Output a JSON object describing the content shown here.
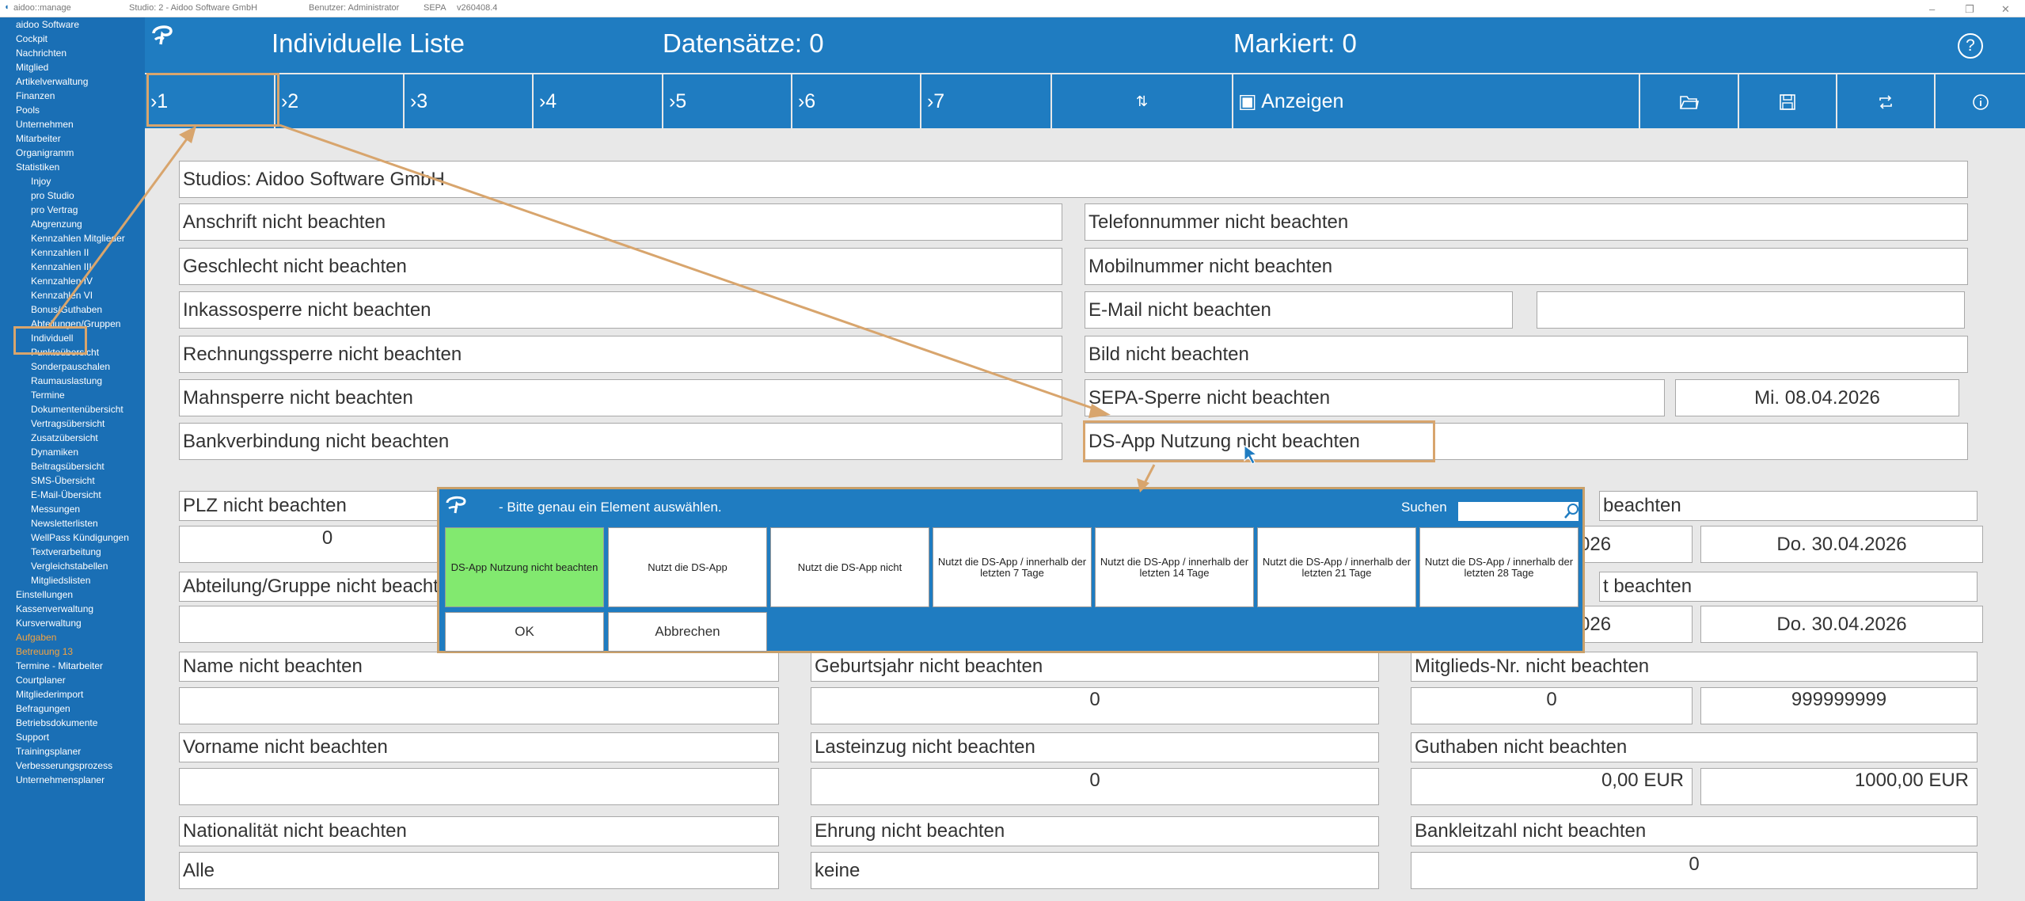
{
  "titlebar": {
    "app": "aidoo::manage",
    "studio": "Studio: 2 - Aidoo Software GmbH",
    "user": "Benutzer: Administrator",
    "sepa": "SEPA",
    "version": "v260408.4",
    "min": "–",
    "max": "❐",
    "close": "✕"
  },
  "sidebar": [
    {
      "label": "aidoo Software",
      "level": 0
    },
    {
      "label": "Cockpit",
      "level": 0
    },
    {
      "label": "Nachrichten",
      "level": 0
    },
    {
      "label": "Mitglied",
      "level": 0
    },
    {
      "label": "Artikelverwaltung",
      "level": 0
    },
    {
      "label": "Finanzen",
      "level": 0
    },
    {
      "label": "Pools",
      "level": 0
    },
    {
      "label": "Unternehmen",
      "level": 0
    },
    {
      "label": "Mitarbeiter",
      "level": 0
    },
    {
      "label": "Organigramm",
      "level": 0
    },
    {
      "label": "Statistiken",
      "level": 0
    },
    {
      "label": "Injoy",
      "level": 1
    },
    {
      "label": "pro Studio",
      "level": 1
    },
    {
      "label": "pro Vertrag",
      "level": 1
    },
    {
      "label": "Abgrenzung",
      "level": 1
    },
    {
      "label": "Kennzahlen Mitglieder",
      "level": 1
    },
    {
      "label": "Kennzahlen II",
      "level": 1
    },
    {
      "label": "Kennzahlen III",
      "level": 1
    },
    {
      "label": "Kennzahlen IV",
      "level": 1
    },
    {
      "label": "Kennzahlen VI",
      "level": 1
    },
    {
      "label": "Bonus/Guthaben",
      "level": 1
    },
    {
      "label": "Abteilungen/Gruppen",
      "level": 1
    },
    {
      "label": "Individuell",
      "level": 1
    },
    {
      "label": "Punkteübersicht",
      "level": 1
    },
    {
      "label": "Sonderpauschalen",
      "level": 1
    },
    {
      "label": "Raumauslastung",
      "level": 1
    },
    {
      "label": "Termine",
      "level": 1
    },
    {
      "label": "Dokumentenübersicht",
      "level": 1
    },
    {
      "label": "Vertragsübersicht",
      "level": 1
    },
    {
      "label": "Zusatzübersicht",
      "level": 1
    },
    {
      "label": "Dynamiken",
      "level": 1
    },
    {
      "label": "Beitragsübersicht",
      "level": 1
    },
    {
      "label": "SMS-Übersicht",
      "level": 1
    },
    {
      "label": "E-Mail-Übersicht",
      "level": 1
    },
    {
      "label": "Messungen",
      "level": 1
    },
    {
      "label": "Newsletterlisten",
      "level": 1
    },
    {
      "label": "WellPass Kündigungen",
      "level": 1
    },
    {
      "label": "Textverarbeitung",
      "level": 1
    },
    {
      "label": "Vergleichstabellen",
      "level": 1
    },
    {
      "label": "Mitgliedslisten",
      "level": 1
    },
    {
      "label": "Einstellungen",
      "level": 0
    },
    {
      "label": "Kassenverwaltung",
      "level": 0
    },
    {
      "label": "Kursverwaltung",
      "level": 0
    },
    {
      "label": "Aufgaben",
      "level": 0,
      "orange": true
    },
    {
      "label": "Betreuung 13",
      "level": 0,
      "orange": true
    },
    {
      "label": "Termine - Mitarbeiter",
      "level": 0
    },
    {
      "label": "Courtplaner",
      "level": 0
    },
    {
      "label": "Mitgliederimport",
      "level": 0
    },
    {
      "label": "Befragungen",
      "level": 0
    },
    {
      "label": "Betriebsdokumente",
      "level": 0
    },
    {
      "label": "Support",
      "level": 0
    },
    {
      "label": "Trainingsplaner",
      "level": 0
    },
    {
      "label": "Verbesserungsprozess",
      "level": 0
    },
    {
      "label": "Unternehmensplaner",
      "level": 0
    }
  ],
  "header": {
    "title": "Individuelle Liste",
    "records": "Datensätze: 0",
    "marked": "Markiert: 0",
    "help": "?"
  },
  "tabs": {
    "t1": "1",
    "t2": "2",
    "t3": "3",
    "t4": "4",
    "t5": "5",
    "t6": "6",
    "t7": "7",
    "sort": "⇅",
    "show": "Anzeigen"
  },
  "fields": {
    "studios": "Studios: Aidoo Software GmbH",
    "anschrift": "Anschrift nicht beachten",
    "telefon": "Telefonnummer nicht beachten",
    "geschlecht": "Geschlecht nicht beachten",
    "mobil": "Mobilnummer nicht beachten",
    "inkasso": "Inkassosperre nicht beachten",
    "email": "E-Mail nicht beachten",
    "email_value": "",
    "rechnung": "Rechnungssperre nicht beachten",
    "bild": "Bild nicht beachten",
    "mahn": "Mahnsperre nicht beachten",
    "sepa": "SEPA-Sperre nicht beachten",
    "sepa_date": "Mi. 08.04.2026",
    "bank": "Bankverbindung nicht beachten",
    "dsapp": "DS-App Nutzung nicht beachten",
    "plz": "PLZ nicht beachten",
    "plz_value": "0",
    "right1": "beachten",
    "date_a": "026",
    "date_b": "Do. 30.04.2026",
    "abteilung": "Abteilung/Gruppe nicht beachten",
    "right2": "t beachten",
    "date_c": "026",
    "date_d": "Do. 30.04.2026",
    "name": "Name nicht beachten",
    "gebjahr": "Geburtsjahr nicht beachten",
    "gebjahr_value": "0",
    "mitgliedsnr": "Mitglieds-Nr. nicht beachten",
    "nr_from": "0",
    "nr_to": "999999999",
    "vorname": "Vorname nicht beachten",
    "lasteinzug": "Lasteinzug nicht beachten",
    "lasteinzug_value": "0",
    "guthaben": "Guthaben nicht beachten",
    "guthaben_from": "0,00 EUR",
    "guthaben_to": "1000,00 EUR",
    "nationalitaet": "Nationalität nicht beachten",
    "nat_value": "Alle",
    "ehrung": "Ehrung nicht beachten",
    "ehrung_value": "keine",
    "blz": "Bankleitzahl nicht beachten",
    "blz_value": "0"
  },
  "dialog": {
    "message": "- Bitte genau ein Element auswählen.",
    "search_label": "Suchen",
    "options": [
      "DS-App Nutzung nicht beachten",
      "Nutzt die DS-App",
      "Nutzt die DS-App nicht",
      "Nutzt die DS-App / innerhalb der letzten 7 Tage",
      "Nutzt die DS-App / innerhalb der letzten 14 Tage",
      "Nutzt die DS-App / innerhalb der letzten 21 Tage",
      "Nutzt die DS-App / innerhalb der letzten 28 Tage"
    ],
    "ok": "OK",
    "cancel": "Abbrechen"
  },
  "colors": {
    "accent": "#1f7cc1",
    "sidebar": "#1a6fb5",
    "highlight": "#d8a56d",
    "selected": "#82e96f"
  }
}
